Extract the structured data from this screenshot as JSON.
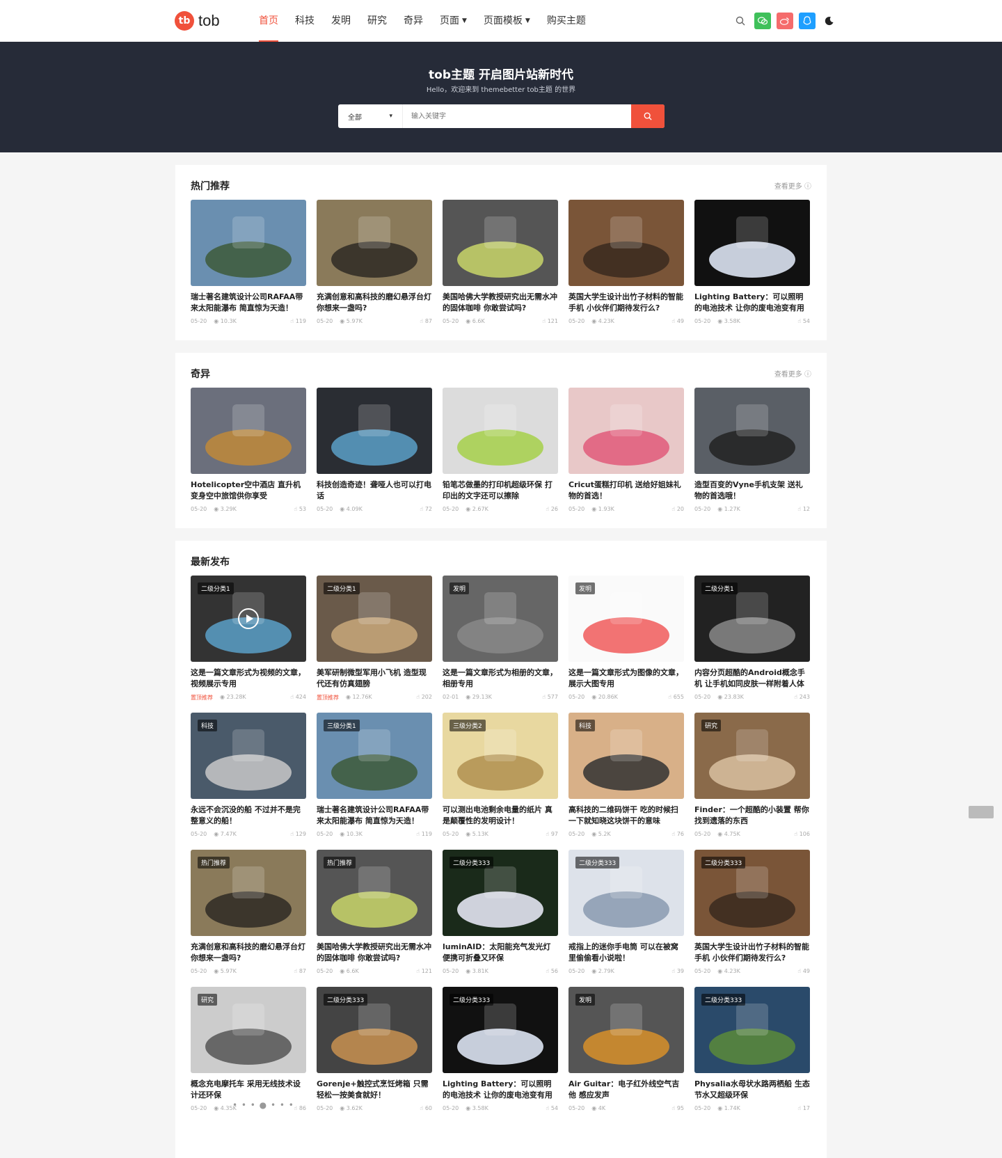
{
  "header": {
    "logo_mark": "tb",
    "logo_text": "tob",
    "nav": [
      {
        "label": "首页",
        "active": true,
        "dropdown": false
      },
      {
        "label": "科技",
        "active": false,
        "dropdown": false
      },
      {
        "label": "发明",
        "active": false,
        "dropdown": false
      },
      {
        "label": "研究",
        "active": false,
        "dropdown": false
      },
      {
        "label": "奇异",
        "active": false,
        "dropdown": false
      },
      {
        "label": "页面",
        "active": false,
        "dropdown": true
      },
      {
        "label": "页面模板",
        "active": false,
        "dropdown": true
      },
      {
        "label": "购买主题",
        "active": false,
        "dropdown": false
      }
    ],
    "tools": [
      "search-icon",
      "wechat-icon",
      "weibo-icon",
      "qq-icon",
      "moon-icon"
    ],
    "tool_colors": {
      "wechat": "#3fc05a",
      "weibo": "#f56c6c",
      "qq": "#1e9fff"
    }
  },
  "hero": {
    "title": "tob主题 开启图片站新时代",
    "subtitle": "Hello，欢迎来到 themebetter tob主题 的世界",
    "category": "全部",
    "placeholder": "输入关键字"
  },
  "colors": {
    "accent": "#f0513b",
    "hero_bg": "#262b38"
  },
  "sections": [
    {
      "title": "热门推荐",
      "more": "查看更多",
      "items": [
        {
          "title": "瑞士著名建筑设计公司RAFAA带来太阳能瀑布 简直惊为天造！",
          "date": "05-20",
          "views": "10.3K",
          "likes": "119",
          "tag": ""
        },
        {
          "title": "充满创意和高科技的磨幻悬浮台灯 你想来一盏吗?",
          "date": "05-20",
          "views": "5.97K",
          "likes": "87",
          "tag": ""
        },
        {
          "title": "美国哈佛大学教授研究出无需水冲的固体咖啡 你敢尝试吗?",
          "date": "05-20",
          "views": "6.6K",
          "likes": "121",
          "tag": ""
        },
        {
          "title": "英国大学生设计出竹子材料的智能手机 小伙伴们期待发行么?",
          "date": "05-20",
          "views": "4.23K",
          "likes": "49",
          "tag": ""
        },
        {
          "title": "Lighting Battery：可以照明的电池技术 让你的废电池变有用",
          "date": "05-20",
          "views": "3.58K",
          "likes": "54",
          "tag": ""
        }
      ]
    },
    {
      "title": "奇异",
      "more": "查看更多",
      "items": [
        {
          "title": "Hotelicopter空中酒店 直升机变身空中旅馆供你享受",
          "date": "05-20",
          "views": "3.29K",
          "likes": "53",
          "tag": ""
        },
        {
          "title": "科技创造奇迹！聋哑人也可以打电话",
          "date": "05-20",
          "views": "4.09K",
          "likes": "72",
          "tag": ""
        },
        {
          "title": "铅笔芯做墨的打印机超级环保 打印出的文字还可以擦除",
          "date": "05-20",
          "views": "2.67K",
          "likes": "26",
          "tag": ""
        },
        {
          "title": "Cricut蛋糕打印机 送给好姐妹礼物的首选！",
          "date": "05-20",
          "views": "1.93K",
          "likes": "20",
          "tag": ""
        },
        {
          "title": "造型百变的Vyne手机支架 送礼物的首选哦！",
          "date": "05-20",
          "views": "1.27K",
          "likes": "12",
          "tag": ""
        }
      ]
    },
    {
      "title": "最新发布",
      "pager": "• • • ● • • •",
      "items": [
        {
          "title": "这是一篇文章形式为视频的文章，视频展示专用",
          "date": "置顶推荐",
          "hot": true,
          "views": "23.28K",
          "likes": "424",
          "tag": "二级分类1",
          "video": true
        },
        {
          "title": "美军研制微型军用小飞机 造型现代还有仿真翅膀",
          "date": "置顶推荐",
          "hot": true,
          "views": "12.76K",
          "likes": "202",
          "tag": "二级分类1"
        },
        {
          "title": "这是一篇文章形式为相册的文章，相册专用",
          "date": "02-01",
          "views": "29.13K",
          "likes": "577",
          "tag": "发明"
        },
        {
          "title": "这是一篇文章形式为图像的文章，展示大图专用",
          "date": "05-20",
          "views": "20.86K",
          "likes": "655",
          "tag": "发明"
        },
        {
          "title": "内容分页超酷的Android概念手机 让手机如同皮肤一样附着人体",
          "date": "05-20",
          "views": "23.83K",
          "likes": "243",
          "tag": "二级分类1"
        },
        {
          "title": "永远不会沉没的船 不过并不是完整意义的船！",
          "date": "05-20",
          "views": "7.47K",
          "likes": "129",
          "tag": "科技"
        },
        {
          "title": "瑞士著名建筑设计公司RAFAA带来太阳能瀑布 简直惊为天造！",
          "date": "05-20",
          "views": "10.3K",
          "likes": "119",
          "tag": "三级分类1"
        },
        {
          "title": "可以测出电池剩余电量的纸片 真是颠覆性的发明设计！",
          "date": "05-20",
          "views": "5.13K",
          "likes": "97",
          "tag": "三级分类2"
        },
        {
          "title": "高科技的二维码饼干 吃的时候扫一下就知晓这块饼干的意味",
          "date": "05-20",
          "views": "5.2K",
          "likes": "76",
          "tag": "科技"
        },
        {
          "title": "Finder：一个超酷的小装置 帮你找到遗落的东西",
          "date": "05-20",
          "views": "4.75K",
          "likes": "106",
          "tag": "研究"
        },
        {
          "title": "充满创意和高科技的磨幻悬浮台灯 你想来一盏吗?",
          "date": "05-20",
          "views": "5.97K",
          "likes": "87",
          "tag": "热门推荐"
        },
        {
          "title": "美国哈佛大学教授研究出无需水冲的固体咖啡 你敢尝试吗?",
          "date": "05-20",
          "views": "6.6K",
          "likes": "121",
          "tag": "热门推荐"
        },
        {
          "title": "luminAID：太阳能充气发光灯 便携可折叠又环保",
          "date": "05-20",
          "views": "3.81K",
          "likes": "56",
          "tag": "二级分类333"
        },
        {
          "title": "戒指上的迷你手电筒 可以在被窝里偷偷看小说啦！",
          "date": "05-20",
          "views": "2.79K",
          "likes": "39",
          "tag": "二级分类333"
        },
        {
          "title": "英国大学生设计出竹子材料的智能手机 小伙伴们期待发行么?",
          "date": "05-20",
          "views": "4.23K",
          "likes": "49",
          "tag": "二级分类333"
        },
        {
          "title": "概念充电摩托车 采用无线技术设计还环保",
          "date": "05-20",
          "views": "4.35K",
          "likes": "86",
          "tag": "研究"
        },
        {
          "title": "Gorenje+触控式烹饪烤箱 只需轻松一按美食就好！",
          "date": "05-20",
          "views": "3.62K",
          "likes": "60",
          "tag": "二级分类333"
        },
        {
          "title": "Lighting Battery：可以照明的电池技术 让你的废电池变有用",
          "date": "05-20",
          "views": "3.58K",
          "likes": "54",
          "tag": "二级分类333"
        },
        {
          "title": "Air Guitar：电子红外线空气吉他 感应发声",
          "date": "05-20",
          "views": "4K",
          "likes": "95",
          "tag": "发明"
        },
        {
          "title": "Physalia水母状水路两栖船 生态节水又超级环保",
          "date": "05-20",
          "views": "1.74K",
          "likes": "17",
          "tag": "二级分类333"
        }
      ]
    }
  ]
}
